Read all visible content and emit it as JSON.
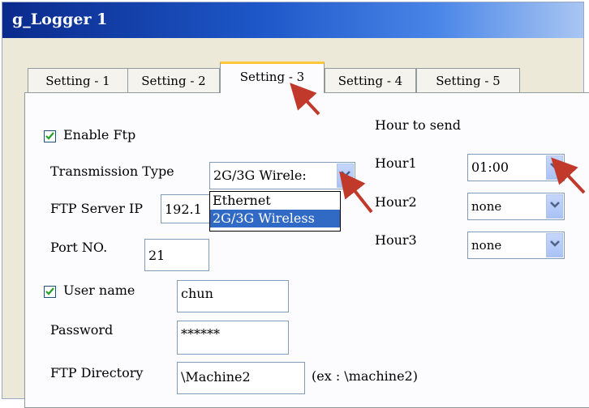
{
  "window": {
    "title": "g_Logger 1"
  },
  "tabs": [
    {
      "label": "Setting - 1"
    },
    {
      "label": "Setting - 2"
    },
    {
      "label": "Setting - 3"
    },
    {
      "label": "Setting - 4"
    },
    {
      "label": "Setting - 5"
    }
  ],
  "ftp": {
    "enable_label": "Enable Ftp",
    "enable_checked": true,
    "transmission_label": "Transmission Type",
    "transmission_value": "2G/3G Wirele:",
    "transmission_options": [
      "Ethernet",
      "2G/3G Wireless"
    ],
    "server_ip_label": "FTP Server IP",
    "server_ip_value": "192.1",
    "port_label": "Port NO.",
    "port_value": "21",
    "username_label": "User name",
    "username_checked": true,
    "username_value": "chun",
    "password_label": "Password",
    "password_value": "******",
    "directory_label": "FTP Directory",
    "directory_value": "\\Machine2",
    "directory_hint": "(ex : \\machine2)"
  },
  "hours": {
    "heading": "Hour to send",
    "items": [
      {
        "label": "Hour1",
        "value": "01:00"
      },
      {
        "label": "Hour2",
        "value": "none"
      },
      {
        "label": "Hour3",
        "value": "none"
      }
    ]
  },
  "colors": {
    "title_bar": "#0a2a8c",
    "tab_highlight": "#ffc83c",
    "selection": "#316ac5",
    "arrow": "#c0392b"
  }
}
